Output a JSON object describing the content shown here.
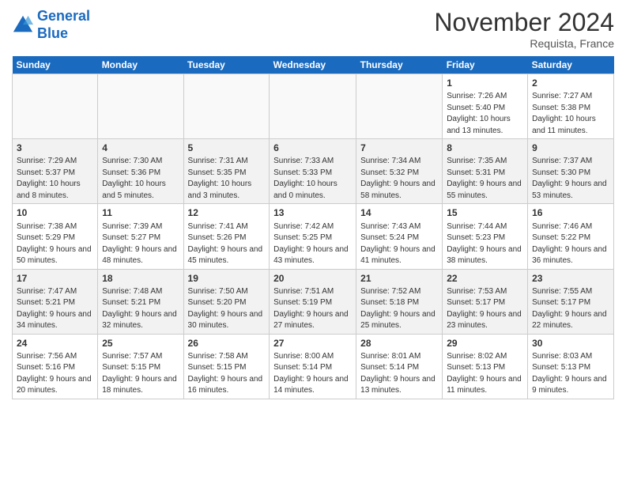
{
  "header": {
    "logo_line1": "General",
    "logo_line2": "Blue",
    "month": "November 2024",
    "location": "Requista, France"
  },
  "days_of_week": [
    "Sunday",
    "Monday",
    "Tuesday",
    "Wednesday",
    "Thursday",
    "Friday",
    "Saturday"
  ],
  "weeks": [
    [
      {
        "day": "",
        "info": ""
      },
      {
        "day": "",
        "info": ""
      },
      {
        "day": "",
        "info": ""
      },
      {
        "day": "",
        "info": ""
      },
      {
        "day": "",
        "info": ""
      },
      {
        "day": "1",
        "info": "Sunrise: 7:26 AM\nSunset: 5:40 PM\nDaylight: 10 hours and 13 minutes."
      },
      {
        "day": "2",
        "info": "Sunrise: 7:27 AM\nSunset: 5:38 PM\nDaylight: 10 hours and 11 minutes."
      }
    ],
    [
      {
        "day": "3",
        "info": "Sunrise: 7:29 AM\nSunset: 5:37 PM\nDaylight: 10 hours and 8 minutes."
      },
      {
        "day": "4",
        "info": "Sunrise: 7:30 AM\nSunset: 5:36 PM\nDaylight: 10 hours and 5 minutes."
      },
      {
        "day": "5",
        "info": "Sunrise: 7:31 AM\nSunset: 5:35 PM\nDaylight: 10 hours and 3 minutes."
      },
      {
        "day": "6",
        "info": "Sunrise: 7:33 AM\nSunset: 5:33 PM\nDaylight: 10 hours and 0 minutes."
      },
      {
        "day": "7",
        "info": "Sunrise: 7:34 AM\nSunset: 5:32 PM\nDaylight: 9 hours and 58 minutes."
      },
      {
        "day": "8",
        "info": "Sunrise: 7:35 AM\nSunset: 5:31 PM\nDaylight: 9 hours and 55 minutes."
      },
      {
        "day": "9",
        "info": "Sunrise: 7:37 AM\nSunset: 5:30 PM\nDaylight: 9 hours and 53 minutes."
      }
    ],
    [
      {
        "day": "10",
        "info": "Sunrise: 7:38 AM\nSunset: 5:29 PM\nDaylight: 9 hours and 50 minutes."
      },
      {
        "day": "11",
        "info": "Sunrise: 7:39 AM\nSunset: 5:27 PM\nDaylight: 9 hours and 48 minutes."
      },
      {
        "day": "12",
        "info": "Sunrise: 7:41 AM\nSunset: 5:26 PM\nDaylight: 9 hours and 45 minutes."
      },
      {
        "day": "13",
        "info": "Sunrise: 7:42 AM\nSunset: 5:25 PM\nDaylight: 9 hours and 43 minutes."
      },
      {
        "day": "14",
        "info": "Sunrise: 7:43 AM\nSunset: 5:24 PM\nDaylight: 9 hours and 41 minutes."
      },
      {
        "day": "15",
        "info": "Sunrise: 7:44 AM\nSunset: 5:23 PM\nDaylight: 9 hours and 38 minutes."
      },
      {
        "day": "16",
        "info": "Sunrise: 7:46 AM\nSunset: 5:22 PM\nDaylight: 9 hours and 36 minutes."
      }
    ],
    [
      {
        "day": "17",
        "info": "Sunrise: 7:47 AM\nSunset: 5:21 PM\nDaylight: 9 hours and 34 minutes."
      },
      {
        "day": "18",
        "info": "Sunrise: 7:48 AM\nSunset: 5:21 PM\nDaylight: 9 hours and 32 minutes."
      },
      {
        "day": "19",
        "info": "Sunrise: 7:50 AM\nSunset: 5:20 PM\nDaylight: 9 hours and 30 minutes."
      },
      {
        "day": "20",
        "info": "Sunrise: 7:51 AM\nSunset: 5:19 PM\nDaylight: 9 hours and 27 minutes."
      },
      {
        "day": "21",
        "info": "Sunrise: 7:52 AM\nSunset: 5:18 PM\nDaylight: 9 hours and 25 minutes."
      },
      {
        "day": "22",
        "info": "Sunrise: 7:53 AM\nSunset: 5:17 PM\nDaylight: 9 hours and 23 minutes."
      },
      {
        "day": "23",
        "info": "Sunrise: 7:55 AM\nSunset: 5:17 PM\nDaylight: 9 hours and 22 minutes."
      }
    ],
    [
      {
        "day": "24",
        "info": "Sunrise: 7:56 AM\nSunset: 5:16 PM\nDaylight: 9 hours and 20 minutes."
      },
      {
        "day": "25",
        "info": "Sunrise: 7:57 AM\nSunset: 5:15 PM\nDaylight: 9 hours and 18 minutes."
      },
      {
        "day": "26",
        "info": "Sunrise: 7:58 AM\nSunset: 5:15 PM\nDaylight: 9 hours and 16 minutes."
      },
      {
        "day": "27",
        "info": "Sunrise: 8:00 AM\nSunset: 5:14 PM\nDaylight: 9 hours and 14 minutes."
      },
      {
        "day": "28",
        "info": "Sunrise: 8:01 AM\nSunset: 5:14 PM\nDaylight: 9 hours and 13 minutes."
      },
      {
        "day": "29",
        "info": "Sunrise: 8:02 AM\nSunset: 5:13 PM\nDaylight: 9 hours and 11 minutes."
      },
      {
        "day": "30",
        "info": "Sunrise: 8:03 AM\nSunset: 5:13 PM\nDaylight: 9 hours and 9 minutes."
      }
    ]
  ]
}
